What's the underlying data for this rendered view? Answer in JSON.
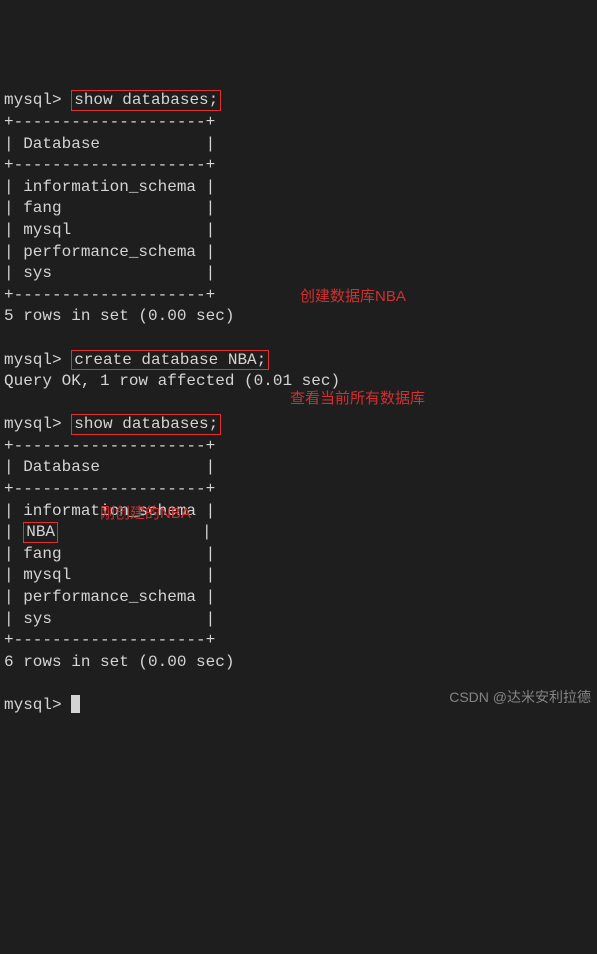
{
  "prompt": "mysql>",
  "cmd1": "show databases;",
  "tableBorder": "+--------------------+",
  "header": "| Database           |",
  "rows1": [
    "| information_schema |",
    "| fang               |",
    "| mysql              |",
    "| performance_schema |",
    "| sys                |"
  ],
  "result1": "5 rows in set (0.00 sec)",
  "cmd2": "create database NBA;",
  "queryOk": "Query OK, 1 row affected (0.01 sec)",
  "cmd3": "show databases;",
  "rows2": {
    "r0": "| information_schema |",
    "r1_pipe": "|",
    "r1_nba": "NBA",
    "r1_rest": "               |",
    "r2": "| fang               |",
    "r3": "| mysql              |",
    "r4": "| performance_schema |",
    "r5": "| sys                |"
  },
  "result2": "6 rows in set (0.00 sec)",
  "annotations": {
    "createNba": "创建数据库NBA",
    "showAll": "查看当前所有数据库",
    "justCreated": "刚创建的NBA"
  },
  "watermark": "CSDN @达米安利拉德"
}
